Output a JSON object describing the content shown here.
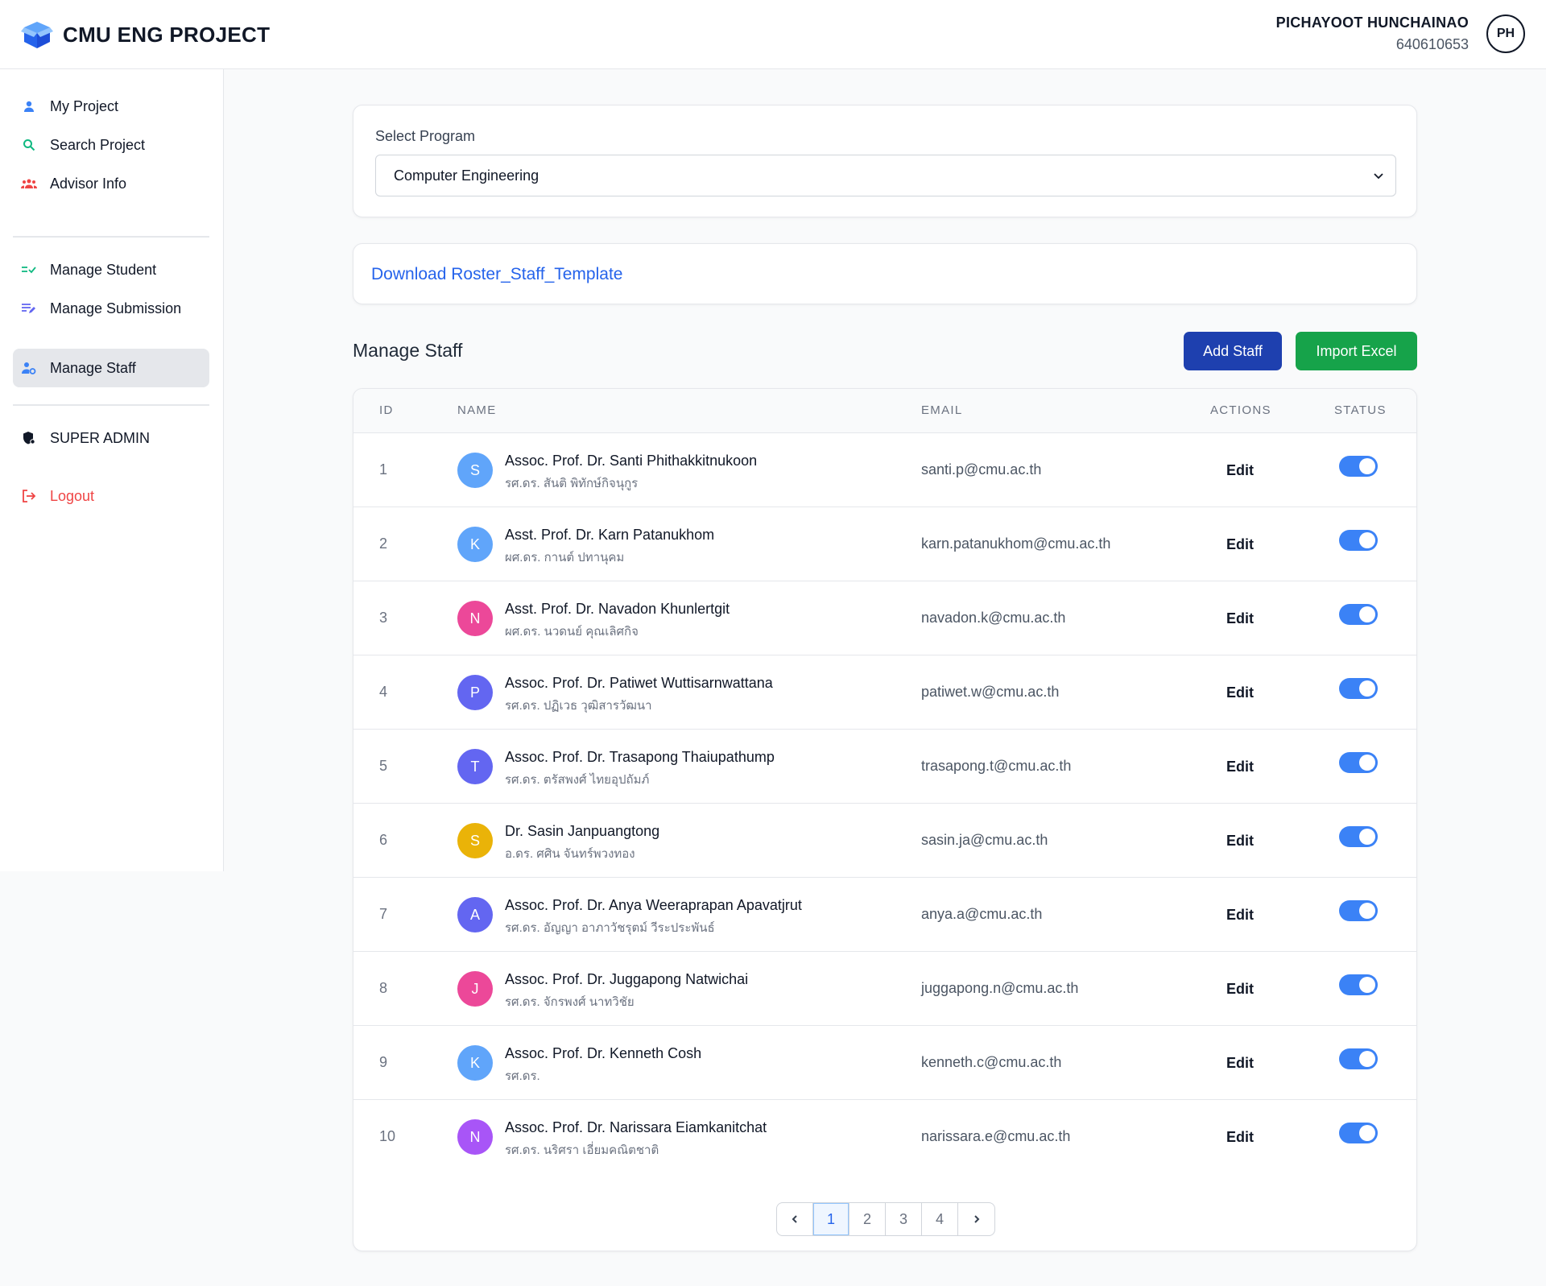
{
  "app": {
    "title": "CMU ENG PROJECT"
  },
  "user": {
    "name": "PICHAYOOT HUNCHAINAO",
    "id": "640610653",
    "initials": "PH"
  },
  "sidebar": {
    "items": [
      {
        "label": "My Project",
        "icon": "person-icon"
      },
      {
        "label": "Search Project",
        "icon": "search-icon"
      },
      {
        "label": "Advisor Info",
        "icon": "group-icon"
      },
      {
        "label": "Manage Student",
        "icon": "checklist-icon"
      },
      {
        "label": "Manage Submission",
        "icon": "edit-list-icon"
      },
      {
        "label": "Manage Staff",
        "icon": "staff-settings-icon",
        "active": true
      },
      {
        "label": "SUPER ADMIN",
        "icon": "shield-icon"
      },
      {
        "label": "Logout",
        "icon": "logout-icon"
      }
    ]
  },
  "program": {
    "label": "Select Program",
    "selected": "Computer Engineering"
  },
  "download": {
    "label": "Download Roster_Staff_Template"
  },
  "manage": {
    "title": "Manage Staff",
    "add_label": "Add Staff",
    "import_label": "Import Excel"
  },
  "table": {
    "headers": {
      "id": "ID",
      "name": "NAME",
      "email": "EMAIL",
      "actions": "ACTIONS",
      "status": "STATUS"
    },
    "edit_label": "Edit",
    "rows": [
      {
        "id": "1",
        "initial": "S",
        "color": "#60a5fa",
        "name_en": "Assoc. Prof. Dr. Santi Phithakkitnukoon",
        "name_th": "รศ.ดร. สันติ พิทักษ์กิจนุกูร",
        "email": "santi.p@cmu.ac.th",
        "active": true
      },
      {
        "id": "2",
        "initial": "K",
        "color": "#60a5fa",
        "name_en": "Asst. Prof. Dr. Karn Patanukhom",
        "name_th": "ผศ.ดร. กานต์ ปทานุคม",
        "email": "karn.patanukhom@cmu.ac.th",
        "active": true
      },
      {
        "id": "3",
        "initial": "N",
        "color": "#ec4899",
        "name_en": "Asst. Prof. Dr. Navadon Khunlertgit",
        "name_th": "ผศ.ดร. นวดนย์ คุณเลิศกิจ",
        "email": "navadon.k@cmu.ac.th",
        "active": true
      },
      {
        "id": "4",
        "initial": "P",
        "color": "#6366f1",
        "name_en": "Assoc. Prof. Dr. Patiwet Wuttisarnwattana",
        "name_th": "รศ.ดร. ปฏิเวธ วุฒิสารวัฒนา",
        "email": "patiwet.w@cmu.ac.th",
        "active": true
      },
      {
        "id": "5",
        "initial": "T",
        "color": "#6366f1",
        "name_en": "Assoc. Prof. Dr. Trasapong Thaiupathump",
        "name_th": "รศ.ดร. ตรัสพงศ์ ไทยอุปถัมภ์",
        "email": "trasapong.t@cmu.ac.th",
        "active": true
      },
      {
        "id": "6",
        "initial": "S",
        "color": "#eab308",
        "name_en": "Dr. Sasin Janpuangtong",
        "name_th": "อ.ดร. ศศิน จันทร์พวงทอง",
        "email": "sasin.ja@cmu.ac.th",
        "active": true
      },
      {
        "id": "7",
        "initial": "A",
        "color": "#6366f1",
        "name_en": "Assoc. Prof. Dr. Anya Weeraprapan Apavatjrut",
        "name_th": "รศ.ดร. อัญญา อาภาวัชรุตม์ วีระประพันธ์",
        "email": "anya.a@cmu.ac.th",
        "active": true
      },
      {
        "id": "8",
        "initial": "J",
        "color": "#ec4899",
        "name_en": "Assoc. Prof. Dr. Juggapong Natwichai",
        "name_th": "รศ.ดร. จักรพงศ์ นาทวิชัย",
        "email": "juggapong.n@cmu.ac.th",
        "active": true
      },
      {
        "id": "9",
        "initial": "K",
        "color": "#60a5fa",
        "name_en": "Assoc. Prof. Dr. Kenneth Cosh",
        "name_th": "รศ.ดร.",
        "email": "kenneth.c@cmu.ac.th",
        "active": true
      },
      {
        "id": "10",
        "initial": "N",
        "color": "#a855f7",
        "name_en": "Assoc. Prof. Dr. Narissara Eiamkanitchat",
        "name_th": "รศ.ดร. นริศรา เอี่ยมคณิตชาติ",
        "email": "narissara.e@cmu.ac.th",
        "active": true
      }
    ]
  },
  "pagination": {
    "pages": [
      "1",
      "2",
      "3",
      "4"
    ],
    "current": "1"
  },
  "colors": {
    "primary": "#1e40af",
    "success": "#16a34a",
    "link": "#2563eb",
    "danger": "#ef4444",
    "toggle_on": "#3b82f6"
  }
}
